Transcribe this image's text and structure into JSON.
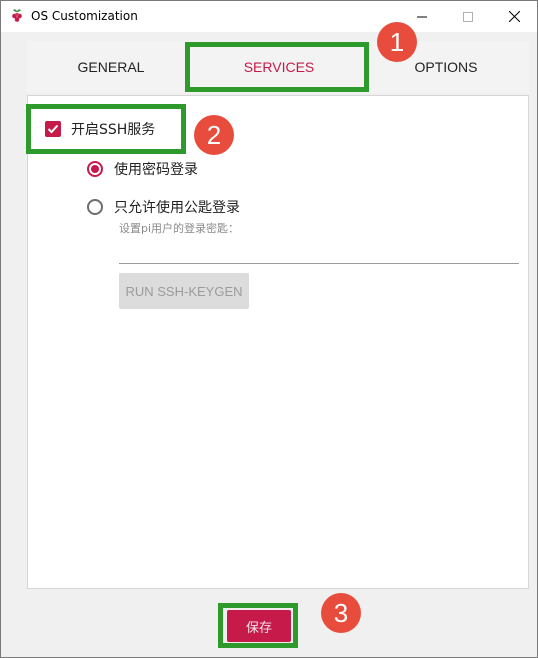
{
  "window": {
    "title": "OS Customization",
    "controls": {
      "minimize": "—",
      "maximize": "☐",
      "close": "✕"
    }
  },
  "tabs": [
    {
      "label": "GENERAL",
      "active": false
    },
    {
      "label": "SERVICES",
      "active": true
    },
    {
      "label": "OPTIONS",
      "active": false
    }
  ],
  "services": {
    "enable_ssh": {
      "label": "开启SSH服务",
      "checked": true
    },
    "auth_options": [
      {
        "label": "使用密码登录",
        "selected": true
      },
      {
        "label": "只允许使用公匙登录",
        "selected": false
      }
    ],
    "public_key_hint": "设置pi用户的登录密匙：",
    "public_key_value": "",
    "keygen_button": "RUN SSH-KEYGEN"
  },
  "footer": {
    "save_button": "保存"
  },
  "annotations": {
    "badge_1": "1",
    "badge_2": "2",
    "badge_3": "3"
  },
  "colors": {
    "accent": "#c51a4a",
    "highlight": "#2e9a2b",
    "badge": "#e74c3c"
  }
}
